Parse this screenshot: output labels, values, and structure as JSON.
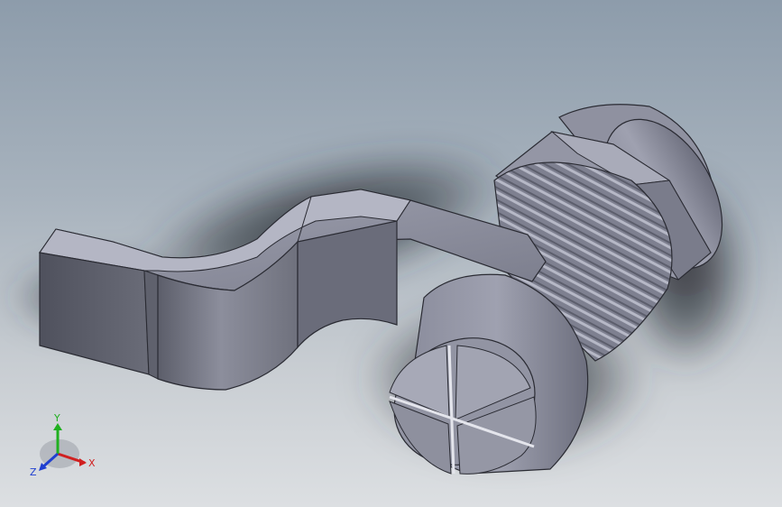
{
  "viewport": {
    "background_top": "#8d9cab",
    "background_bottom": "#dcdfe2",
    "part_color": "#7d7f8f"
  },
  "triad": {
    "x_label": "X",
    "y_label": "Y",
    "z_label": "Z",
    "x_color": "#d02020",
    "y_color": "#20b020",
    "z_color": "#2040d0"
  }
}
